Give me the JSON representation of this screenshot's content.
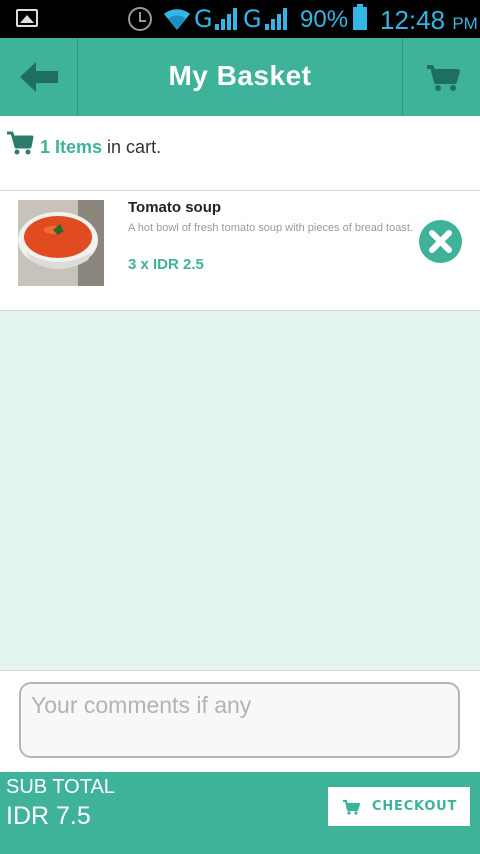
{
  "status_bar": {
    "network_1": "G",
    "network_2": "G",
    "battery": "90%",
    "time": "12:48",
    "ampm": "PM"
  },
  "header": {
    "title": "My Basket",
    "back_icon": "arrow-left-icon",
    "cart_icon": "shopping-cart-icon"
  },
  "summary": {
    "count": "1 Items",
    "suffix": " in cart."
  },
  "cart_items": [
    {
      "name": "Tomato soup",
      "description": "A hot bowl of fresh tomato soup with pieces of bread toast.",
      "price": "3 x IDR 2.5",
      "remove_icon": "remove-x-icon"
    }
  ],
  "comments": {
    "placeholder": "Your comments if any",
    "value": ""
  },
  "footer": {
    "subtotal_label": "SUB TOTAL",
    "subtotal_value": "IDR 7.5",
    "checkout_label": "CHECKOUT"
  },
  "colors": {
    "accent": "#3fb39a",
    "status_text": "#33b5e5",
    "body_bg": "#e3f4f1"
  }
}
